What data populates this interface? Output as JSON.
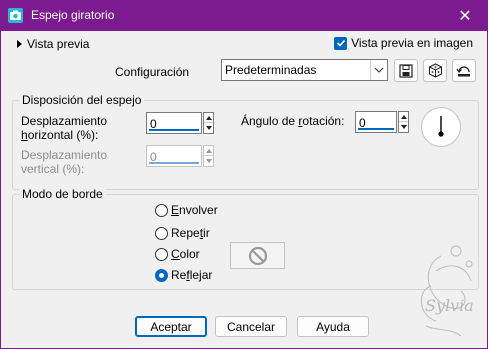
{
  "window": {
    "title": "Espejo giratorio",
    "close_glyph": "✕"
  },
  "preview": {
    "toggle_label": "Vista previa",
    "checkbox_label": "Vista previa en imagen",
    "checkbox_checked": true
  },
  "config": {
    "label": "Configuración",
    "selected": "Predeterminadas",
    "tools": [
      "save-icon",
      "dice-icon",
      "reset-icon"
    ]
  },
  "mirror_group": {
    "title": "Disposición del espejo",
    "h_offset": {
      "label_line1": "Desplazamiento",
      "label_line2_pre": "",
      "label_line2_hot": "h",
      "label_line2_post": "orizontal (%):",
      "value": "0",
      "enabled": true
    },
    "v_offset": {
      "label_line1": "Desplazamiento",
      "label_line2": "vertical (%):",
      "value": "0",
      "enabled": false
    },
    "rotation": {
      "label_pre": "Ángulo de ",
      "label_hot": "r",
      "label_post": "otación:",
      "value": "0"
    }
  },
  "border_group": {
    "title": "Modo de borde",
    "options": [
      {
        "pre": "",
        "hot": "E",
        "post": "nvolver",
        "checked": false
      },
      {
        "pre": "Repe",
        "hot": "t",
        "post": "ir",
        "checked": false
      },
      {
        "pre": "",
        "hot": "C",
        "post": "olor",
        "checked": false
      },
      {
        "pre": "Re",
        "hot": "f",
        "post": "lejar",
        "checked": true
      }
    ]
  },
  "watermark_text": "Sylvia",
  "buttons": {
    "ok": "Aceptar",
    "cancel": "Cancelar",
    "help": "Ayuda"
  },
  "colors": {
    "titlebar": "#7b1b8f",
    "accent": "#0067c0",
    "dialog_bg": "#f0f0f0"
  }
}
